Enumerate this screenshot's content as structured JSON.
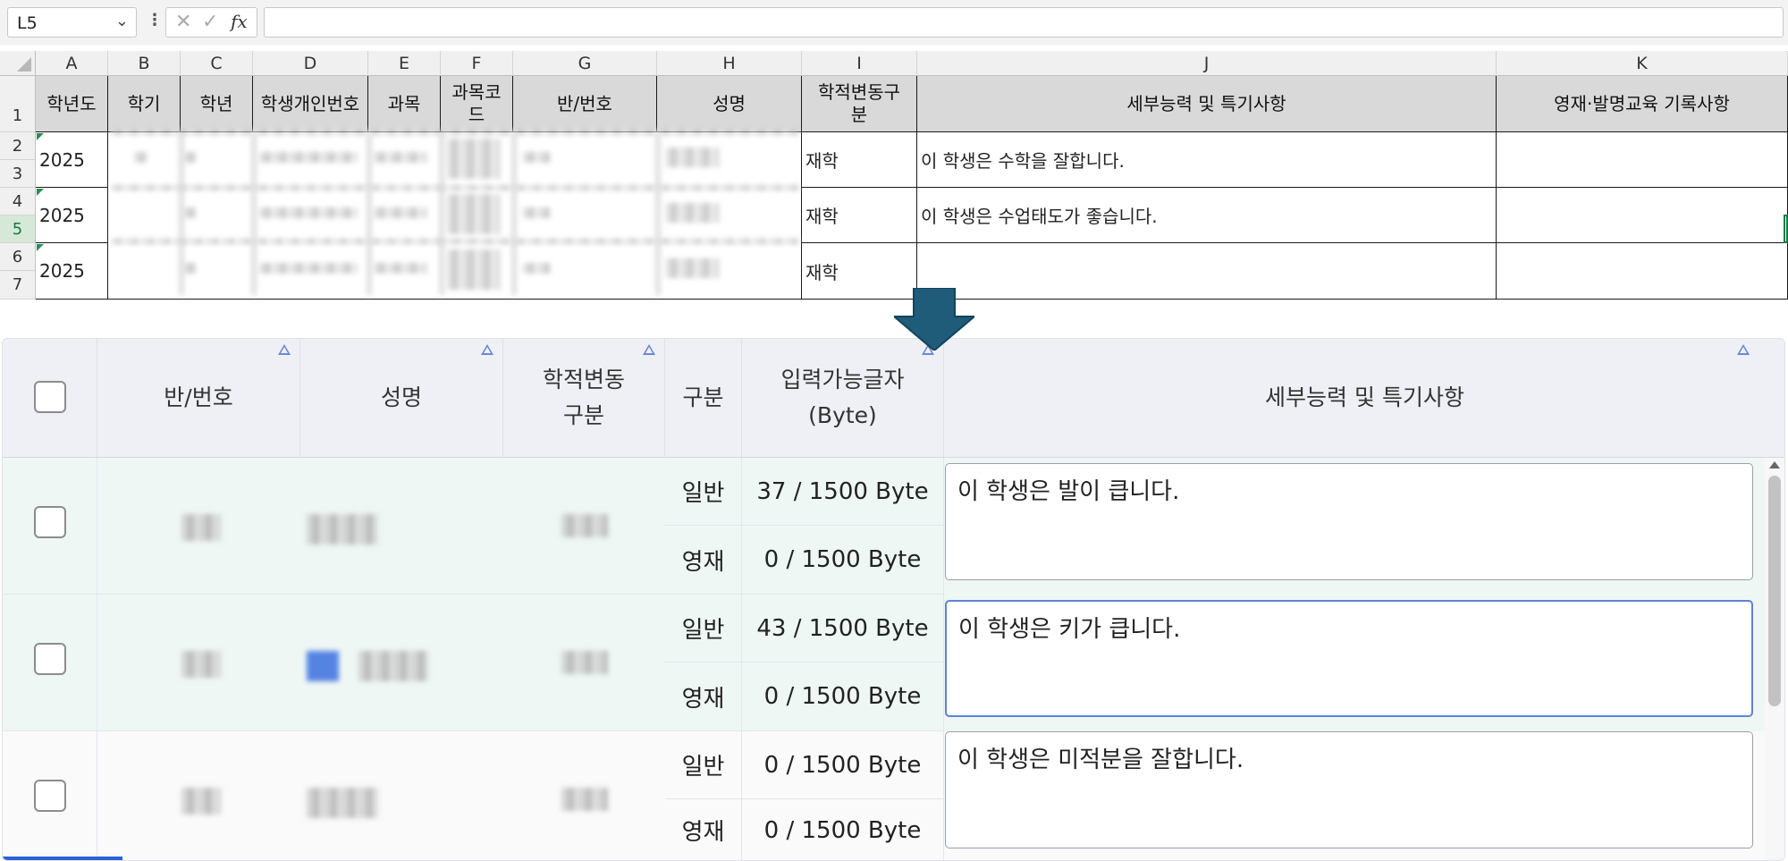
{
  "formula_bar": {
    "name_box": "L5",
    "x": "✕",
    "check": "✓",
    "fx": "fx",
    "formula": ""
  },
  "sheet": {
    "columns": [
      "A",
      "B",
      "C",
      "D",
      "E",
      "F",
      "G",
      "H",
      "I",
      "J",
      "K"
    ],
    "rows": [
      "1",
      "2",
      "3",
      "4",
      "5",
      "6",
      "7"
    ],
    "headers": {
      "A": "학년도",
      "B": "학기",
      "C": "학년",
      "D": "학생개인번호",
      "E": "과목",
      "F": "과목코드",
      "G": "반/번호",
      "H": "성명",
      "I": "학적변동구분",
      "J": "세부능력 및 특기사항",
      "K": "영재·발명교육 기록사항"
    },
    "data": [
      {
        "year": "2025",
        "status": "재학",
        "detail": "이 학생은 수학을 잘합니다."
      },
      {
        "year": "2025",
        "status": "재학",
        "detail": "이 학생은 수업태도가 좋습니다."
      },
      {
        "year": "2025",
        "status": "재학",
        "detail": ""
      }
    ]
  },
  "web_table": {
    "headers": {
      "class_no": "반/번호",
      "name": "성명",
      "status": "학적변동구분",
      "type": "구분",
      "bytes": "입력가능글자(Byte)",
      "detail": "세부능력 및 특기사항"
    },
    "rows": [
      {
        "general_label": "일반",
        "general_bytes": "37 / 1500 Byte",
        "gifted_label": "영재",
        "gifted_bytes": "0 / 1500 Byte",
        "text": "이 학생은 발이 큽니다."
      },
      {
        "general_label": "일반",
        "general_bytes": "43 / 1500 Byte",
        "gifted_label": "영재",
        "gifted_bytes": "0 / 1500 Byte",
        "text": "이 학생은 키가 큽니다."
      },
      {
        "general_label": "일반",
        "general_bytes": "0 / 1500 Byte",
        "gifted_label": "영재",
        "gifted_bytes": "0 / 1500 Byte",
        "text": "이 학생은 미적분을 잘합니다."
      }
    ]
  }
}
